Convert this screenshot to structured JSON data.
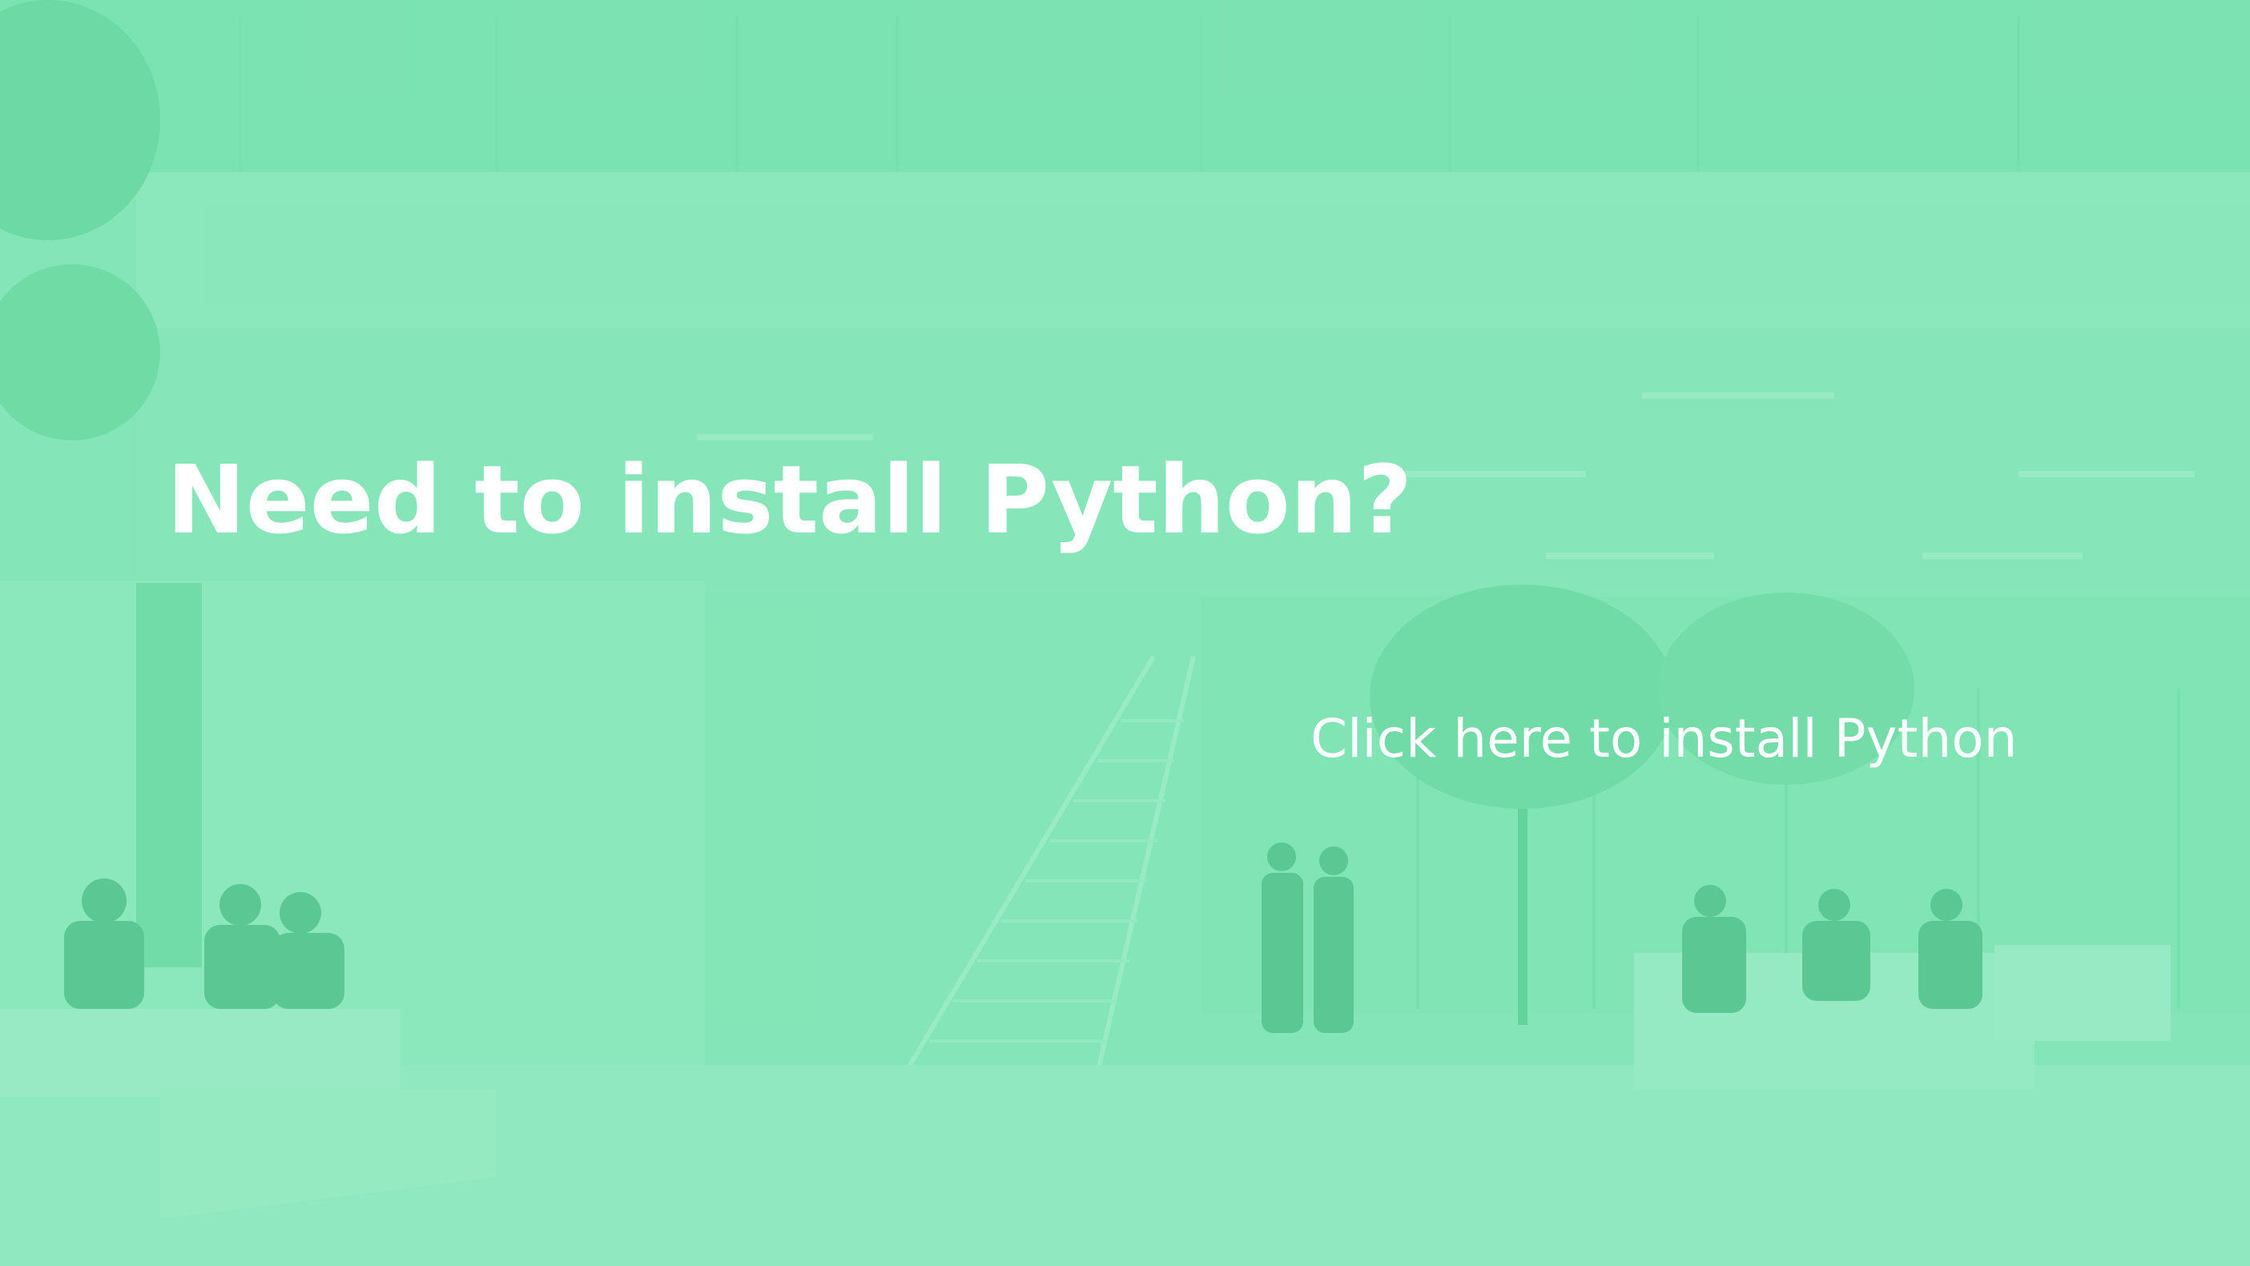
{
  "hero": {
    "headline": "Need to install Python?",
    "link_label": "Click here to install Python"
  },
  "colors": {
    "overlay_tint": "#5CDBA2",
    "text": "#FFFFFF"
  }
}
